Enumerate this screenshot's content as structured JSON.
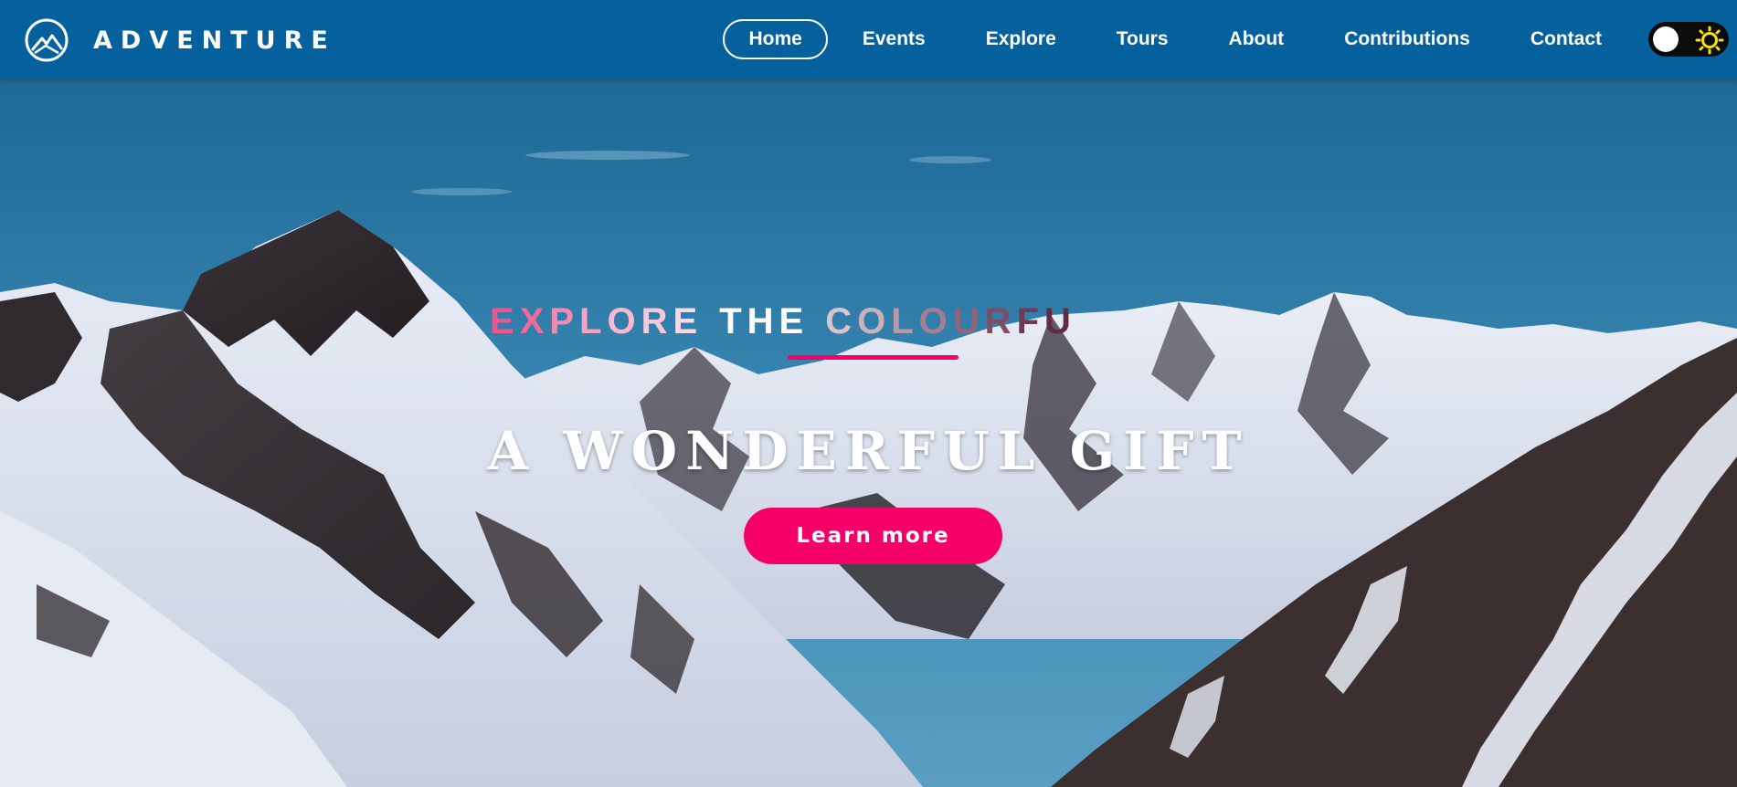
{
  "brand": {
    "name": "ADVENTURE",
    "logo": "mountain-circle-logo"
  },
  "nav": {
    "items": [
      {
        "label": "Home",
        "active": true
      },
      {
        "label": "Events"
      },
      {
        "label": "Explore"
      },
      {
        "label": "Tours"
      },
      {
        "label": "About"
      },
      {
        "label": "Contributions"
      },
      {
        "label": "Contact"
      }
    ]
  },
  "theme_toggle": {
    "state": "light",
    "icon": "sun-icon"
  },
  "hero": {
    "tagline": {
      "word1": "EXPLORE",
      "word2": "THE",
      "word3": "COLOURFU",
      "colors": {
        "word1": [
          "#f0558e",
          "#f26a9a",
          "#f48aae",
          "#f7a2bf",
          "#f8b8cd",
          "#f8c8d8",
          "#fad8e4"
        ],
        "word2": "#ffffff",
        "word3": [
          "#d8c4cc",
          "#c9b0bb",
          "#b899a8",
          "#a57e92",
          "#92647c",
          "#7f4d66",
          "#6e3a55",
          "#5e2c47"
        ]
      }
    },
    "headline": "A WONDERFUL GIFT",
    "cta_label": "Learn more"
  },
  "colors": {
    "navbar": "#04619e",
    "accent": "#f50068",
    "sky_top": "#1c6a9a",
    "sky_bottom": "#4f95bd"
  }
}
